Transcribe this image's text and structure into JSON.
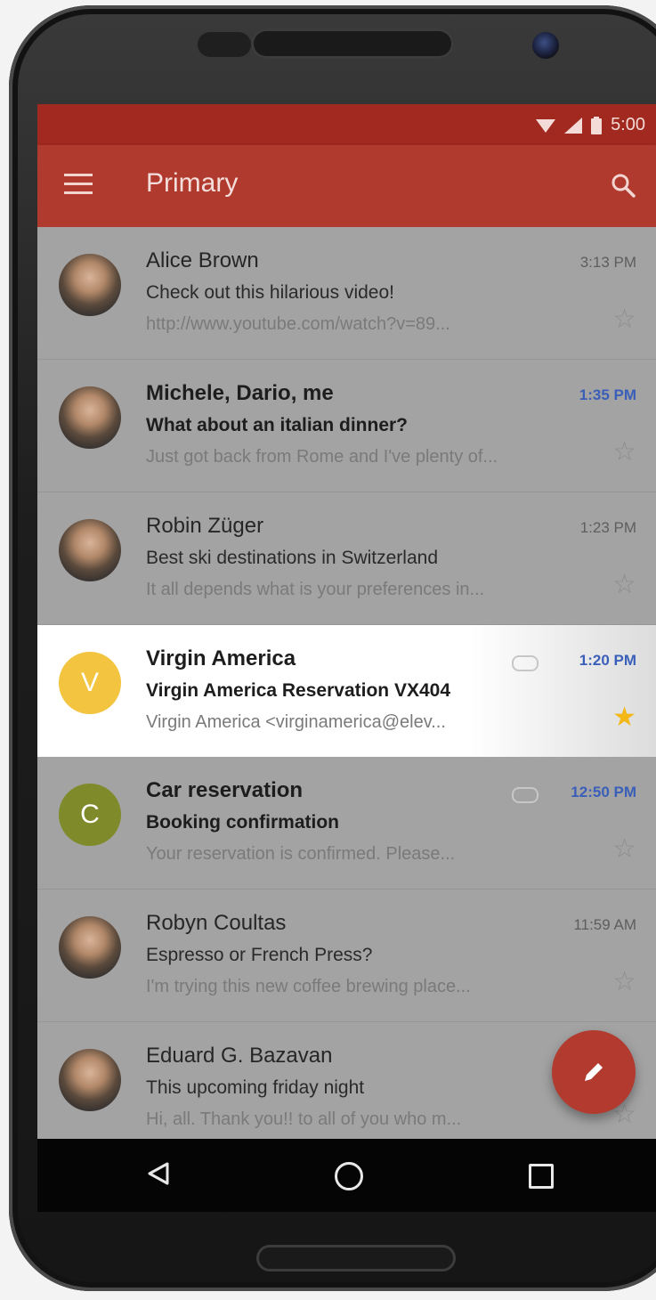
{
  "status_bar": {
    "time": "5:00"
  },
  "app_bar": {
    "title": "Primary"
  },
  "emails": [
    {
      "sender": "Alice Brown",
      "subject": "Check out this hilarious video!",
      "snippet": "http://www.youtube.com/watch?v=89...",
      "time": "3:13 PM",
      "unread": false,
      "starred": false,
      "attachment": false,
      "avatar_type": "photo",
      "highlight": false
    },
    {
      "sender": "Michele, Dario, me",
      "subject": "What about an italian dinner?",
      "snippet": "Just got back from Rome and I've plenty of...",
      "time": "1:35 PM",
      "unread": true,
      "starred": false,
      "attachment": false,
      "avatar_type": "photo",
      "highlight": false
    },
    {
      "sender": "Robin Züger",
      "subject": "Best ski destinations in Switzerland",
      "snippet": "It all depends what is your preferences in...",
      "time": "1:23 PM",
      "unread": false,
      "starred": false,
      "attachment": false,
      "avatar_type": "photo",
      "highlight": false
    },
    {
      "sender": "Virgin America",
      "subject": "Virgin America Reservation VX404",
      "snippet": "Virgin America <virginamerica@elev...",
      "time": "1:20 PM",
      "unread": true,
      "starred": true,
      "attachment": true,
      "avatar_type": "letter",
      "avatar_letter": "V",
      "avatar_color": "#f2c440",
      "highlight": true
    },
    {
      "sender": "Car reservation",
      "subject": "Booking confirmation",
      "snippet": "Your reservation is confirmed. Please...",
      "time": "12:50 PM",
      "unread": true,
      "starred": false,
      "attachment": true,
      "avatar_type": "letter",
      "avatar_letter": "C",
      "avatar_color": "#7f8b2a",
      "highlight": false
    },
    {
      "sender": "Robyn Coultas",
      "subject": "Espresso or French Press?",
      "snippet": "I'm trying this new coffee brewing place...",
      "time": "11:59 AM",
      "unread": false,
      "starred": false,
      "attachment": false,
      "avatar_type": "photo",
      "highlight": false
    },
    {
      "sender": "Eduard G. Bazavan",
      "subject": "This upcoming friday night",
      "snippet": "Hi, all. Thank you!! to all of you who m...",
      "time": "",
      "unread": false,
      "starred": false,
      "attachment": false,
      "avatar_type": "photo",
      "highlight": false
    }
  ],
  "colors": {
    "status_bar": "#a1291f",
    "app_bar": "#b03a2e",
    "fab": "#b23a2f",
    "unread_time": "#3a5fb8",
    "star_filled": "#f3b818"
  },
  "icons": {
    "menu": "menu-icon",
    "search": "search-icon",
    "compose": "pencil-icon",
    "back": "back-triangle-icon",
    "home": "home-circle-icon",
    "recent": "recent-square-icon"
  }
}
